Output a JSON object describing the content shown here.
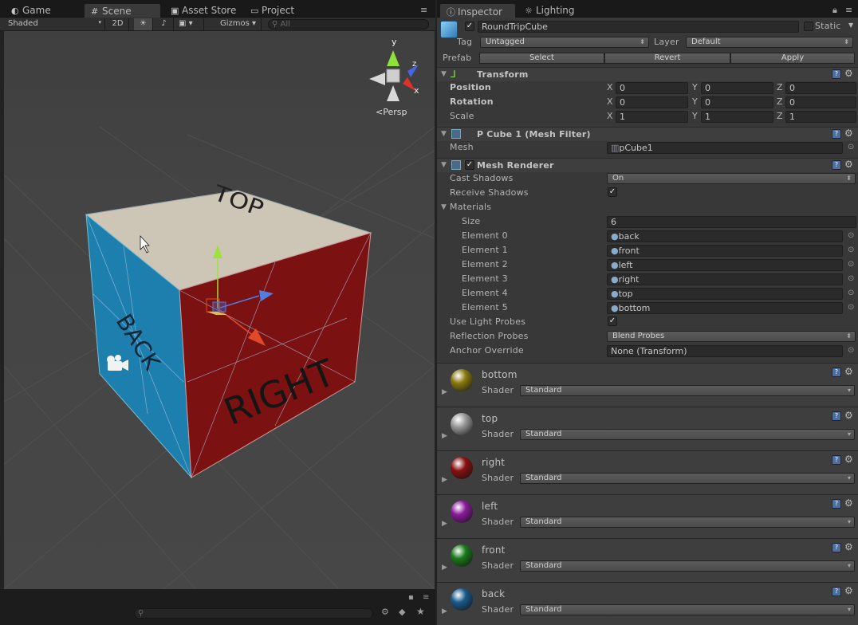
{
  "scene_tabs": [
    {
      "label": "Game",
      "icon": "pacman-icon"
    },
    {
      "label": "Scene",
      "icon": "grid-icon"
    },
    {
      "label": "Asset Store",
      "icon": "bag-icon"
    },
    {
      "label": "Project",
      "icon": "folder-icon"
    }
  ],
  "inspector_tabs": [
    {
      "label": "Inspector",
      "icon": "info-icon"
    },
    {
      "label": "Lighting",
      "icon": "lighting-icon"
    }
  ],
  "scene_toolbar": {
    "shading": "Shaded",
    "mode_2d": "2D",
    "gizmos": "Gizmos",
    "search_placeholder": "All"
  },
  "scene_view": {
    "projection": "Persp",
    "axis_labels": {
      "y": "y",
      "x": "x",
      "z": "z"
    },
    "cube_faces": {
      "top": "TOP",
      "right": "RIGHT",
      "left": "BACK"
    },
    "colors": {
      "top": "#cdc6b7",
      "right": "#7a1010",
      "left": "#1e7aa3"
    }
  },
  "inspector": {
    "object_name": "RoundTripCube",
    "active": true,
    "static_label": "Static",
    "tag_label": "Tag",
    "tag_value": "Untagged",
    "layer_label": "Layer",
    "layer_value": "Default",
    "prefab_label": "Prefab",
    "prefab_buttons": [
      "Select",
      "Revert",
      "Apply"
    ],
    "transform": {
      "title": "Transform",
      "rows": [
        {
          "label": "Position",
          "x": "0",
          "y": "0",
          "z": "0",
          "bold": true
        },
        {
          "label": "Rotation",
          "x": "0",
          "y": "0",
          "z": "0",
          "bold": true
        },
        {
          "label": "Scale",
          "x": "1",
          "y": "1",
          "z": "1",
          "bold": false
        }
      ],
      "axis": [
        "X",
        "Y",
        "Z"
      ]
    },
    "mesh_filter": {
      "title": "P Cube 1 (Mesh Filter)",
      "mesh_label": "Mesh",
      "mesh_value": "pCube1"
    },
    "mesh_renderer": {
      "title": "Mesh Renderer",
      "cast_shadows_label": "Cast Shadows",
      "cast_shadows_value": "On",
      "receive_shadows_label": "Receive Shadows",
      "materials_label": "Materials",
      "size_label": "Size",
      "size_value": "6",
      "elements": [
        {
          "label": "Element 0",
          "value": "back"
        },
        {
          "label": "Element 1",
          "value": "front"
        },
        {
          "label": "Element 2",
          "value": "left"
        },
        {
          "label": "Element 3",
          "value": "right"
        },
        {
          "label": "Element 4",
          "value": "top"
        },
        {
          "label": "Element 5",
          "value": "bottom"
        }
      ],
      "light_probes_label": "Use Light Probes",
      "reflection_label": "Reflection Probes",
      "reflection_value": "Blend Probes",
      "anchor_label": "Anchor Override",
      "anchor_value": "None (Transform)"
    },
    "materials": [
      {
        "name": "bottom",
        "shader_label": "Shader",
        "shader": "Standard",
        "color": "#8a7a10"
      },
      {
        "name": "top",
        "shader_label": "Shader",
        "shader": "Standard",
        "color": "#9a9a9a"
      },
      {
        "name": "right",
        "shader_label": "Shader",
        "shader": "Standard",
        "color": "#8a1010"
      },
      {
        "name": "left",
        "shader_label": "Shader",
        "shader": "Standard",
        "color": "#8a1a9a"
      },
      {
        "name": "front",
        "shader_label": "Shader",
        "shader": "Standard",
        "color": "#1a7a1a"
      },
      {
        "name": "back",
        "shader_label": "Shader",
        "shader": "Standard",
        "color": "#1a5a8a"
      }
    ]
  }
}
